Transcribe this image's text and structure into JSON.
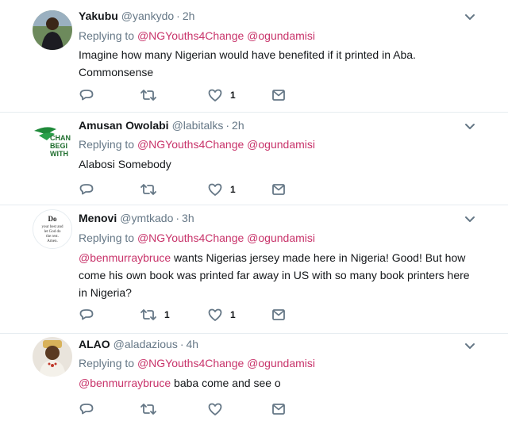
{
  "tweets": [
    {
      "name": "Yakubu",
      "handle": "@yankydo",
      "time": "2h",
      "replying_prefix": "Replying to",
      "reply_to": [
        "@NGYouths4Change",
        "@ogundamisi"
      ],
      "text_lines": [
        "Imagine how many Nigerian would have benefited if it printed in Aba.",
        "Commonsense"
      ],
      "retweets": "",
      "likes": "1"
    },
    {
      "name": "Amusan Owolabi",
      "handle": "@labitalks",
      "time": "2h",
      "replying_prefix": "Replying to",
      "reply_to": [
        "@NGYouths4Change",
        "@ogundamisi"
      ],
      "text_lines": [
        "Alabosi Somebody"
      ],
      "avatar_text": [
        "CHAN",
        "BEGI",
        "WITH"
      ],
      "retweets": "",
      "likes": "1"
    },
    {
      "name": "Menovi",
      "handle": "@ymtkado",
      "time": "3h",
      "replying_prefix": "Replying to",
      "reply_to": [
        "@NGYouths4Change",
        "@ogundamisi"
      ],
      "mention": "@benmurraybruce",
      "text_lines": [
        " wants Nigerias jersey made here in Nigeria! Good! But how",
        "come his own book was printed far away in US with so many book printers here",
        "in Nigeria?"
      ],
      "avatar_text": [
        "Do",
        "your best and",
        "let God do",
        "the rest.",
        "Amen."
      ],
      "retweets": "1",
      "likes": "1"
    },
    {
      "name": "ALAO",
      "handle": "@aladazious",
      "time": "4h",
      "replying_prefix": "Replying to",
      "reply_to": [
        "@NGYouths4Change",
        "@ogundamisi"
      ],
      "mention": "@benmurraybruce",
      "text_lines": [
        " baba come and see o"
      ],
      "retweets": "",
      "likes": ""
    }
  ],
  "colors": {
    "link": "#c8336a",
    "muted": "#657786",
    "divider": "#e6ecf0"
  },
  "icons": [
    "reply-icon",
    "retweet-icon",
    "like-icon",
    "direct-message-icon",
    "chevron-down-icon"
  ]
}
